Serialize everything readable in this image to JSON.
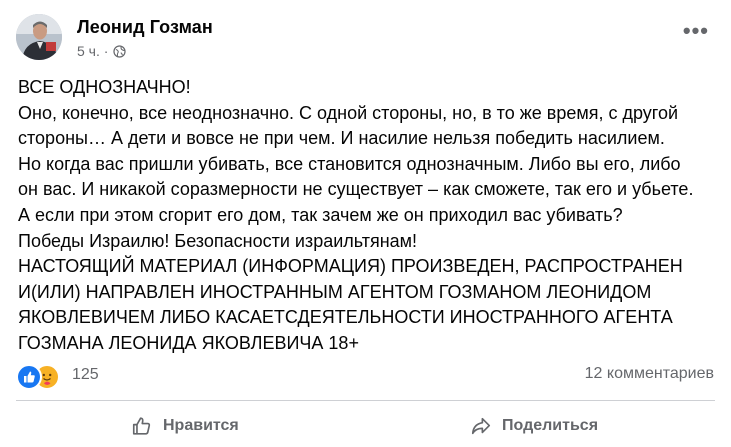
{
  "post": {
    "author": "Леонид Гозман",
    "timestamp": "5 ч. ·",
    "audience_icon": "globe-icon",
    "more_label": "•••",
    "lines": [
      "ВСЕ ОДНОЗНАЧНО!",
      "Оно, конечно, все неоднозначно. С одной стороны, но, в то же время, с другой",
      "стороны… А дети и вовсе не при чем. И насилие нельзя победить насилием.",
      "Но когда вас пришли убивать, все становится однозначным. Либо вы его, либо",
      "он вас. И никакой соразмерности не существует – как сможете, так его и убьете.",
      "А если при этом сгорит его дом, так зачем же он приходил вас убивать?",
      "Победы Израилю! Безопасности израильтянам!",
      "НАСТОЯЩИЙ МАТЕРИАЛ (ИНФОРМАЦИЯ) ПРОИЗВЕДЕН, РАСПРОСТРАНЕН",
      "И(ИЛИ) НАПРАВЛЕН ИНОСТРАННЫМ АГЕНТОМ ГОЗМАНОМ ЛЕОНИДОМ",
      "ЯКОВЛЕВИЧЕМ ЛИБО КАСАЕТСДЕЯТЕЛЬНОСТИ ИНОСТРАННОГО АГЕНТА",
      "ГОЗМАНА ЛЕОНИДА ЯКОВЛЕВИЧА 18+"
    ]
  },
  "stats": {
    "reaction_icons": [
      "like-icon",
      "care-icon"
    ],
    "reaction_count": "125",
    "comments": "12 комментариев"
  },
  "actions": {
    "like_label": "Нравится",
    "share_label": "Поделиться"
  },
  "colors": {
    "text": "#050505",
    "secondary": "#65676b",
    "like_blue": "#1877f2",
    "care_yellow": "#f7b125",
    "divider": "#ced0d4"
  }
}
